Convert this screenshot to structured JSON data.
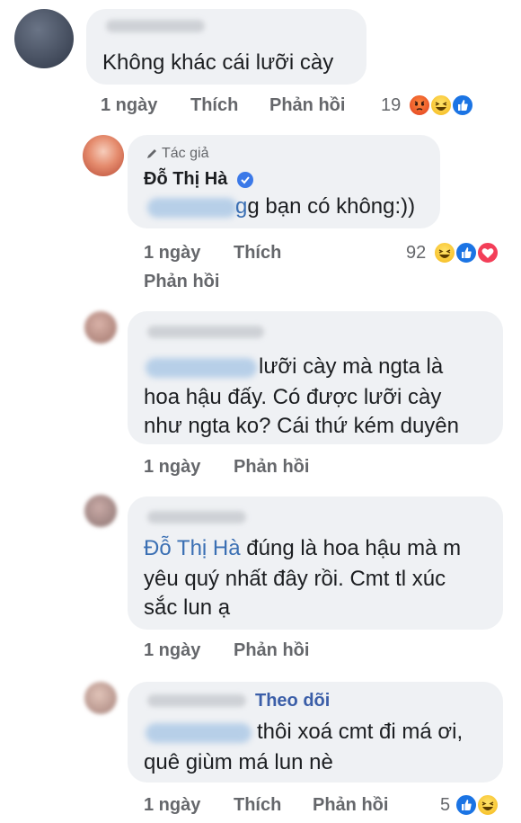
{
  "comments": [
    {
      "text": "Không khác cái lưỡi cày",
      "time": "1 ngày",
      "like": "Thích",
      "reply": "Phản hồi",
      "reaction_count": "19",
      "reactions": [
        "angry-icon",
        "haha-icon",
        "like-icon"
      ]
    },
    {
      "author_label": "Tác giả",
      "author_name": "Đỗ Thị Hà",
      "text_suffix": "g bạn có không:))",
      "time": "1 ngày",
      "like": "Thích",
      "reply": "Phản hồi",
      "reaction_count": "92",
      "reactions": [
        "haha-icon",
        "like-icon",
        "love-icon"
      ]
    },
    {
      "line1": "lưỡi cày mà ngta là",
      "line2": "hoa hậu đấy. Có được lưỡi cày",
      "line3": "như ngta ko?  Cái thứ kém duyên",
      "time": "1 ngày",
      "reply": "Phản hồi"
    },
    {
      "mention": "Đỗ Thị Hà",
      "line1": " đúng là hoa hậu mà m",
      "line2": "yêu quý nhất đây rồi.  Cmt tl xúc",
      "line3": "sắc lun ạ",
      "time": "1 ngày",
      "reply": "Phản hồi"
    },
    {
      "follow": "Theo dõi",
      "line1": "thôi xoá cmt đi má ơi,",
      "line2": "quê giùm má lun nè",
      "time": "1 ngày",
      "like": "Thích",
      "reply": "Phản hồi",
      "reaction_count": "5",
      "reactions": [
        "like-icon",
        "haha-icon"
      ]
    }
  ],
  "colors": {
    "bubble": "#eff1f4",
    "mention": "#3a6fb3",
    "meta": "#65676b",
    "like": "#1b74e4",
    "love": "#f33e58"
  }
}
